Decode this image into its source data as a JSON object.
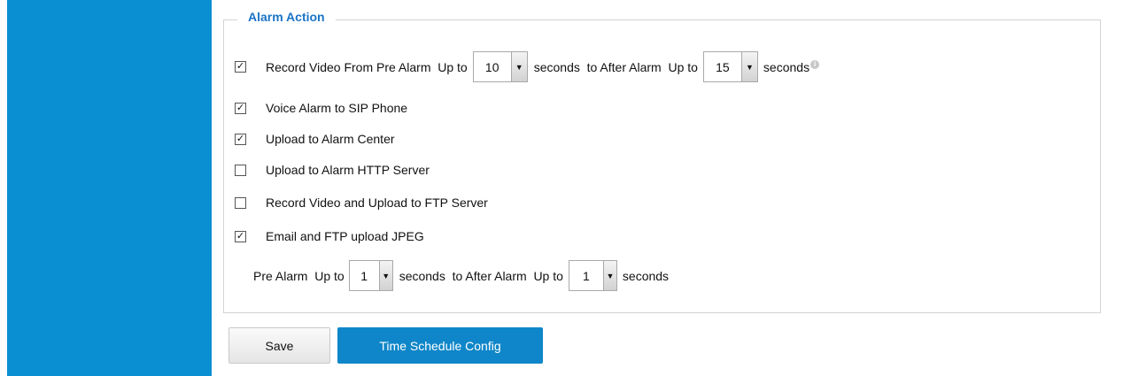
{
  "legend": "Alarm Action",
  "record_pre": {
    "checked": true,
    "label": "Record Video From Pre Alarm  Up to",
    "pre_value": "10",
    "middle_text": "seconds  to After Alarm  Up to",
    "post_value": "15",
    "suffix": "seconds",
    "info_icon": "info-icon"
  },
  "options": [
    {
      "label": "Voice Alarm to SIP Phone",
      "checked": true
    },
    {
      "label": "Upload to Alarm Center",
      "checked": true
    },
    {
      "label": "Upload to Alarm HTTP Server",
      "checked": false
    },
    {
      "label": "Record Video and Upload to FTP Server",
      "checked": false
    },
    {
      "label": "Email and FTP upload JPEG",
      "checked": true
    }
  ],
  "jpeg": {
    "label": "Pre Alarm  Up to",
    "pre_value": "1",
    "middle_text": "seconds  to After Alarm  Up to",
    "post_value": "1",
    "suffix": "seconds"
  },
  "buttons": {
    "save": "Save",
    "schedule": "Time Schedule Config"
  },
  "colors": {
    "sidebar": "#0b8fd3",
    "accent": "#1b74c7",
    "primary_button": "#0f86c9"
  }
}
